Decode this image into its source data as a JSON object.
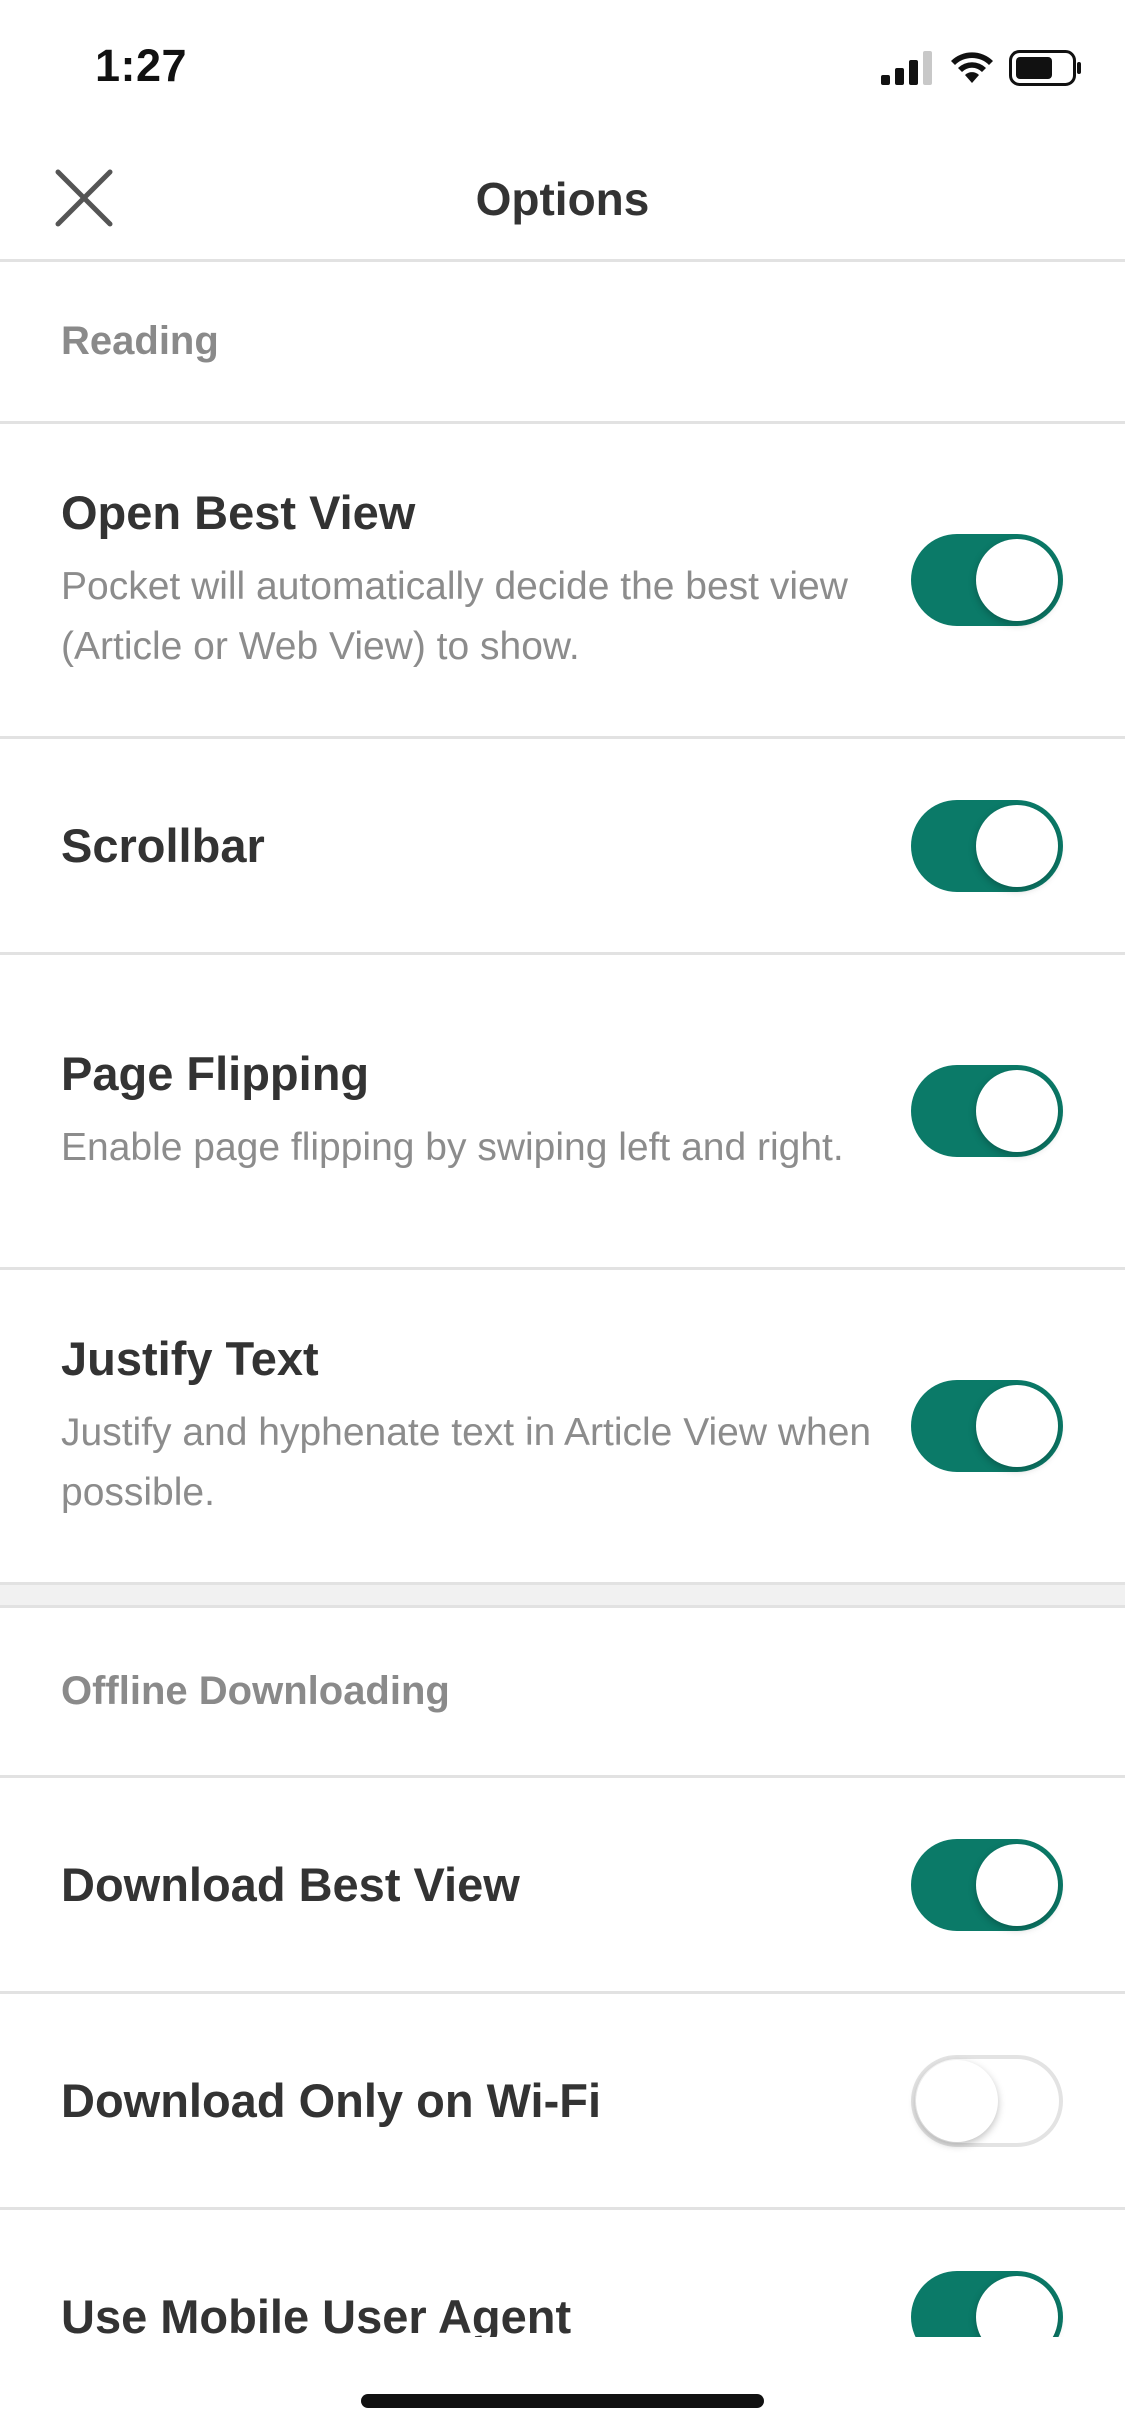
{
  "status_bar": {
    "time": "1:27",
    "icons": [
      "signal-icon",
      "wifi-icon",
      "battery-icon"
    ]
  },
  "nav": {
    "title": "Options",
    "close_icon": "close-icon"
  },
  "colors": {
    "accent": "#0b7a68",
    "title_text": "#333333",
    "secondary_text": "#8c8c8c",
    "divider": "#e2e2e2"
  },
  "sections": [
    {
      "header": "Reading",
      "rows": [
        {
          "title": "Open Best View",
          "description": "Pocket will automatically decide the best view (Article or Web View) to show.",
          "enabled": true
        },
        {
          "title": "Scrollbar",
          "description": "",
          "enabled": true
        },
        {
          "title": "Page Flipping",
          "description": "Enable page flipping by swiping left and right.",
          "enabled": true
        },
        {
          "title": "Justify Text",
          "description": "Justify and hyphenate text in Article View when possible.",
          "enabled": true
        }
      ]
    },
    {
      "header": "Offline Downloading",
      "rows": [
        {
          "title": "Download Best View",
          "description": "",
          "enabled": true
        },
        {
          "title": "Download Only on Wi-Fi",
          "description": "",
          "enabled": false
        },
        {
          "title": "Use Mobile User Agent",
          "description": "",
          "enabled": true
        }
      ]
    }
  ]
}
